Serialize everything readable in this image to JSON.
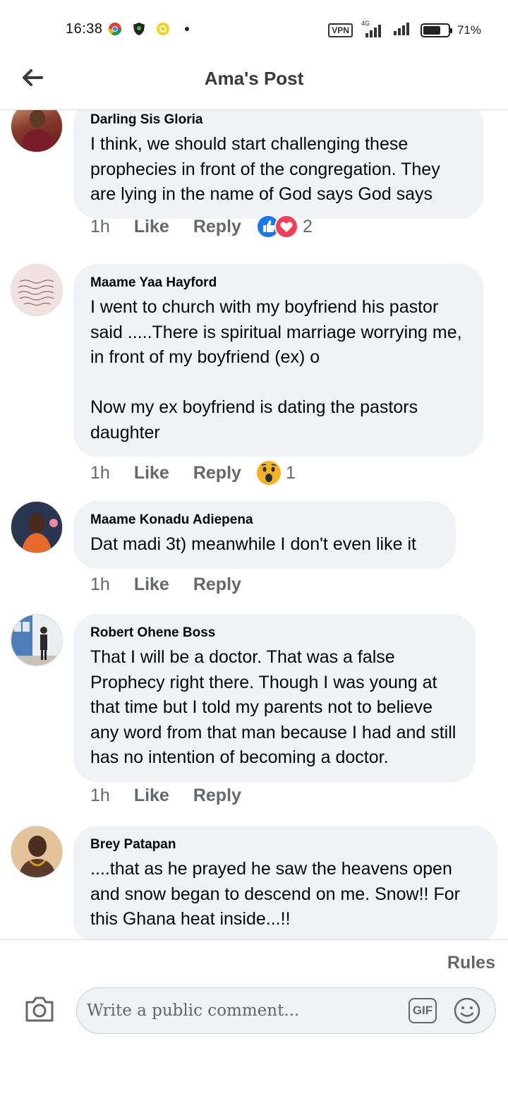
{
  "status_bar": {
    "time": "16:38",
    "vpn": "VPN",
    "network": "4G",
    "battery": "71%",
    "battery_level": 0.71
  },
  "header": {
    "title": "Ama's Post"
  },
  "comments": [
    {
      "author": "Darling Sis Gloria",
      "text": "I think, we should start challenging these prophecies in front of the congregation. They are lying in the name of God says God says",
      "time": "1h",
      "like": "Like",
      "reply": "Reply",
      "reaction_count": "2",
      "reactions": [
        "like-icon",
        "love-icon"
      ]
    },
    {
      "author": "Maame Yaa Hayford",
      "text": "I went to church with my boyfriend his pastor said .....There is spiritual marriage worrying me, in front of my boyfriend (ex) o\n\nNow my ex boyfriend is dating the pastors daughter",
      "time": "1h",
      "like": "Like",
      "reply": "Reply",
      "reaction_count": "1",
      "reactions": [
        "wow-icon"
      ]
    },
    {
      "author": "Maame Konadu Adiepena",
      "text": "Dat madi 3t) meanwhile I don't even like it",
      "time": "1h",
      "like": "Like",
      "reply": "Reply"
    },
    {
      "author": "Robert Ohene Boss",
      "text": "That I will be a doctor. That was a false Prophecy right there. Though I was young at that time but I told my parents not to believe any word from that man because I had and still has no intention of becoming a doctor.",
      "time": "1h",
      "like": "Like",
      "reply": "Reply"
    },
    {
      "author": "Brey Patapan",
      "text": "....that as he prayed he saw the heavens open and snow began to descend on me. Snow!! For this Ghana heat inside...!!"
    }
  ],
  "composer": {
    "rules": "Rules",
    "placeholder": "Write a public comment...",
    "gif": "GIF"
  },
  "colors": {
    "bubble": "#f0f2f5",
    "secondary_text": "#65676b",
    "like_blue": "#1877f2",
    "love_red": "#f33e58",
    "wow_yellow": "#f7b125"
  }
}
